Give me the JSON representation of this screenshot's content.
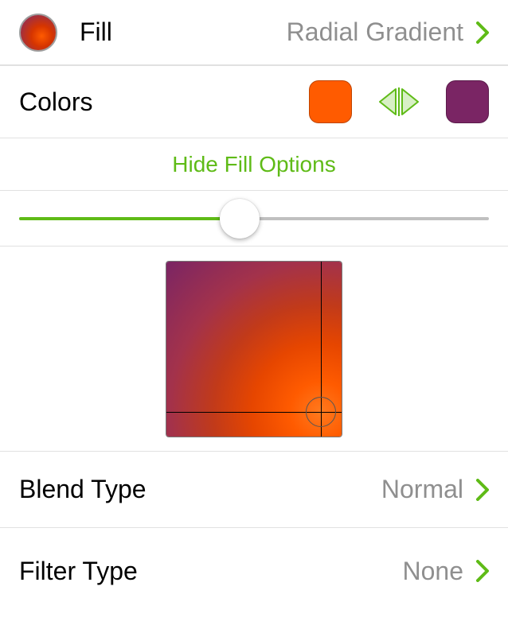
{
  "fill": {
    "label": "Fill",
    "type": "Radial Gradient"
  },
  "colors": {
    "label": "Colors",
    "start": "#ff5b00",
    "end": "#7a2564"
  },
  "toggle": {
    "hide_label": "Hide Fill Options"
  },
  "slider": {
    "percent": 47
  },
  "preview": {
    "center_x_pct": 88,
    "center_y_pct": 86
  },
  "blend": {
    "label": "Blend Type",
    "value": "Normal"
  },
  "filter": {
    "label": "Filter Type",
    "value": "None"
  },
  "accent": "#5fbb17"
}
